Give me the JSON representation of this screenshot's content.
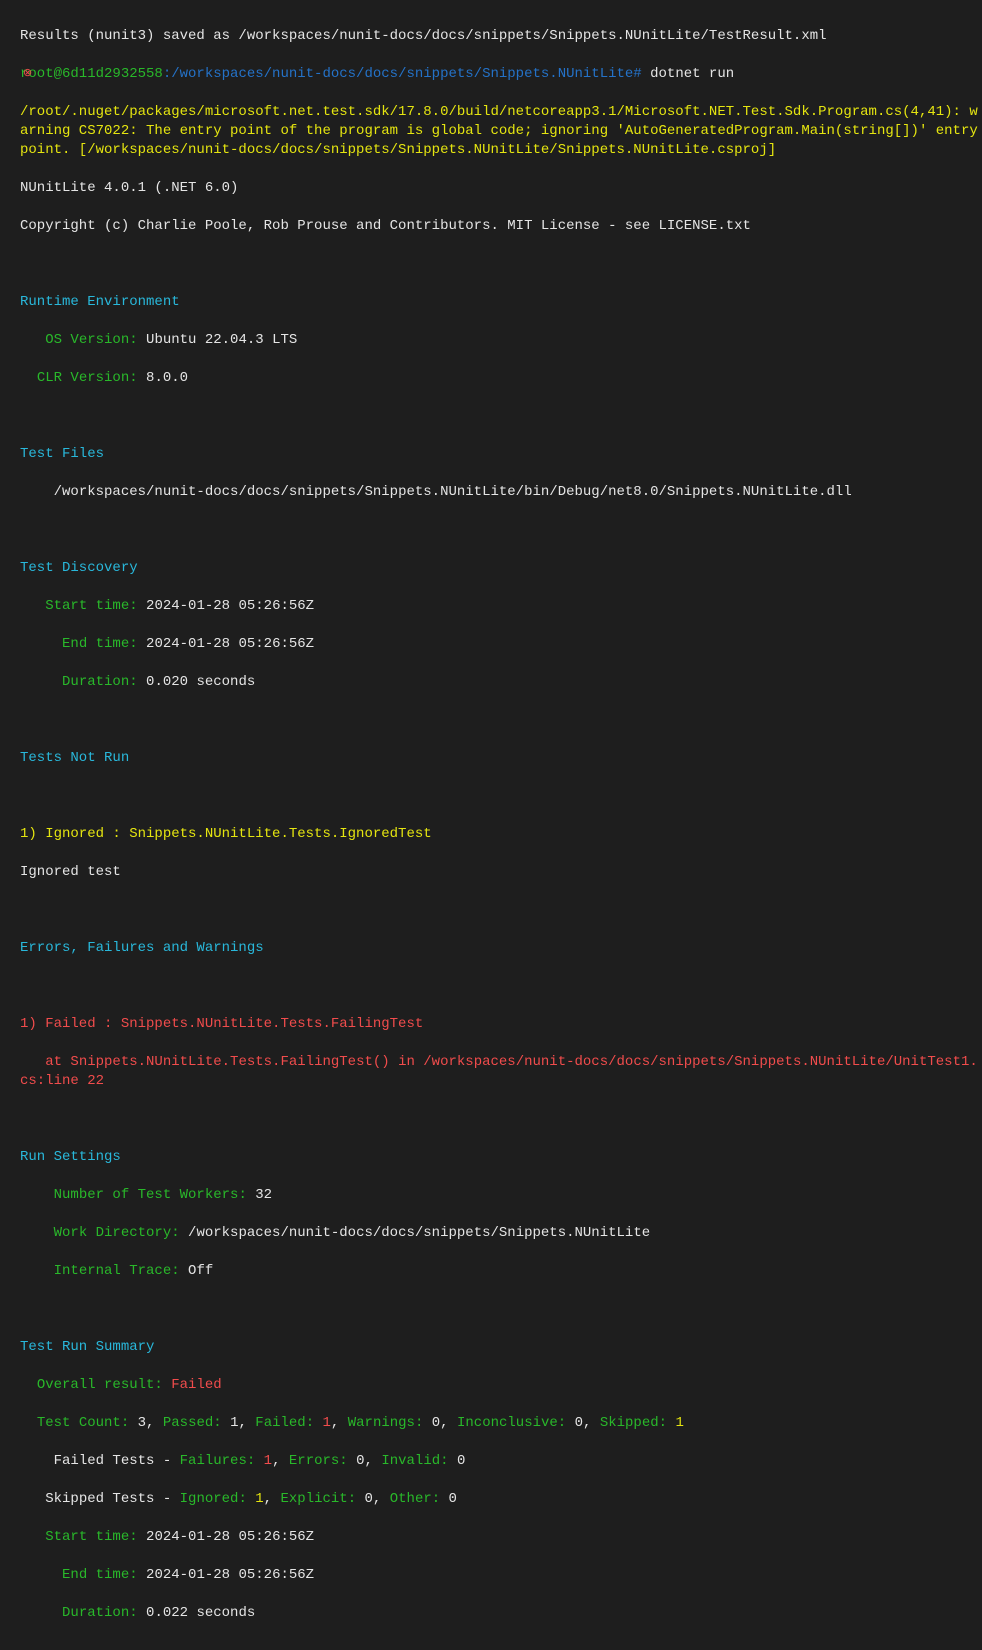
{
  "line1": "Results (nunit3) saved as /workspaces/nunit-docs/docs/snippets/Snippets.NUnitLite/TestResult.xml",
  "prompt_user": "root@6d11d2932558",
  "prompt_path": ":/workspaces/nunit-docs/docs/snippets/Snippets.NUnitLite#",
  "prompt_cmd": " dotnet run",
  "warning": "/root/.nuget/packages/microsoft.net.test.sdk/17.8.0/build/netcoreapp3.1/Microsoft.NET.Test.Sdk.Program.cs(4,41): warning CS7022: The entry point of the program is global code; ignoring 'AutoGeneratedProgram.Main(string[])' entry point. [/workspaces/nunit-docs/docs/snippets/Snippets.NUnitLite/Snippets.NUnitLite.csproj]",
  "nunitlite_version": "NUnitLite 4.0.1 (.NET 6.0)",
  "copyright": "Copyright (c) Charlie Poole, Rob Prouse and Contributors. MIT License - see LICENSE.txt",
  "runtime_env": "Runtime Environment",
  "os_label": "   OS Version:",
  "os_value": " Ubuntu 22.04.3 LTS",
  "clr_label": "  CLR Version:",
  "clr_value": " 8.0.0",
  "test_files": "Test Files",
  "test_file_path": "    /workspaces/nunit-docs/docs/snippets/Snippets.NUnitLite/bin/Debug/net8.0/Snippets.NUnitLite.dll",
  "test_discovery": "Test Discovery",
  "disc_start_label": "   Start time:",
  "disc_start_value": " 2024-01-28 05:26:56Z",
  "disc_end_label": "     End time:",
  "disc_end_value": " 2024-01-28 05:26:56Z",
  "disc_dur_label": "     Duration:",
  "disc_dur_value": " 0.020 seconds",
  "tests_not_run": "Tests Not Run",
  "ignored_line": "1) Ignored : Snippets.NUnitLite.Tests.IgnoredTest",
  "ignored_msg": "Ignored test",
  "errors_header": "Errors, Failures and Warnings",
  "failed_line": "1) Failed : Snippets.NUnitLite.Tests.FailingTest",
  "failed_stack": "   at Snippets.NUnitLite.Tests.FailingTest() in /workspaces/nunit-docs/docs/snippets/Snippets.NUnitLite/UnitTest1.cs:line 22",
  "run_settings": "Run Settings",
  "workers_label": "    Number of Test Workers:",
  "workers_value": " 32",
  "workdir_label": "    Work Directory:",
  "workdir_value": " /workspaces/nunit-docs/docs/snippets/Snippets.NUnitLite",
  "trace_label": "    Internal Trace:",
  "trace_value": " Off",
  "summary": "Test Run Summary",
  "overall_label": "  Overall result:",
  "overall_value": " Failed",
  "tc_label": "  Test Count:",
  "tc_val": " 3",
  "comma": ", ",
  "passed_label": "Passed:",
  "passed_val": " 1",
  "failed_label": "Failed:",
  "failed_val": " 1",
  "warn_label": "Warnings:",
  "warn_val": " 0",
  "incon_label": "Inconclusive:",
  "incon_val": " 0",
  "skip_label": "Skipped:",
  "skip_val": " 1",
  "ft_prefix": "    Failed Tests - ",
  "ft_fail_label": "Failures:",
  "ft_fail_val": " 1",
  "ft_err_label": "Errors:",
  "ft_err_val": " 0",
  "ft_inv_label": "Invalid:",
  "ft_inv_val": " 0",
  "st_prefix": "   Skipped Tests - ",
  "st_ign_label": "Ignored:",
  "st_ign_val": " 1",
  "st_exp_label": "Explicit:",
  "st_exp_val": " 0",
  "st_oth_label": "Other:",
  "st_oth_val": " 0",
  "sum_start_label": "   Start time:",
  "sum_start_value": " 2024-01-28 05:26:56Z",
  "sum_end_label": "     End time:",
  "sum_end_value": " 2024-01-28 05:26:56Z",
  "sum_dur_label": "     Duration:",
  "sum_dur_value": " 0.022 seconds",
  "gutter": "⊗"
}
